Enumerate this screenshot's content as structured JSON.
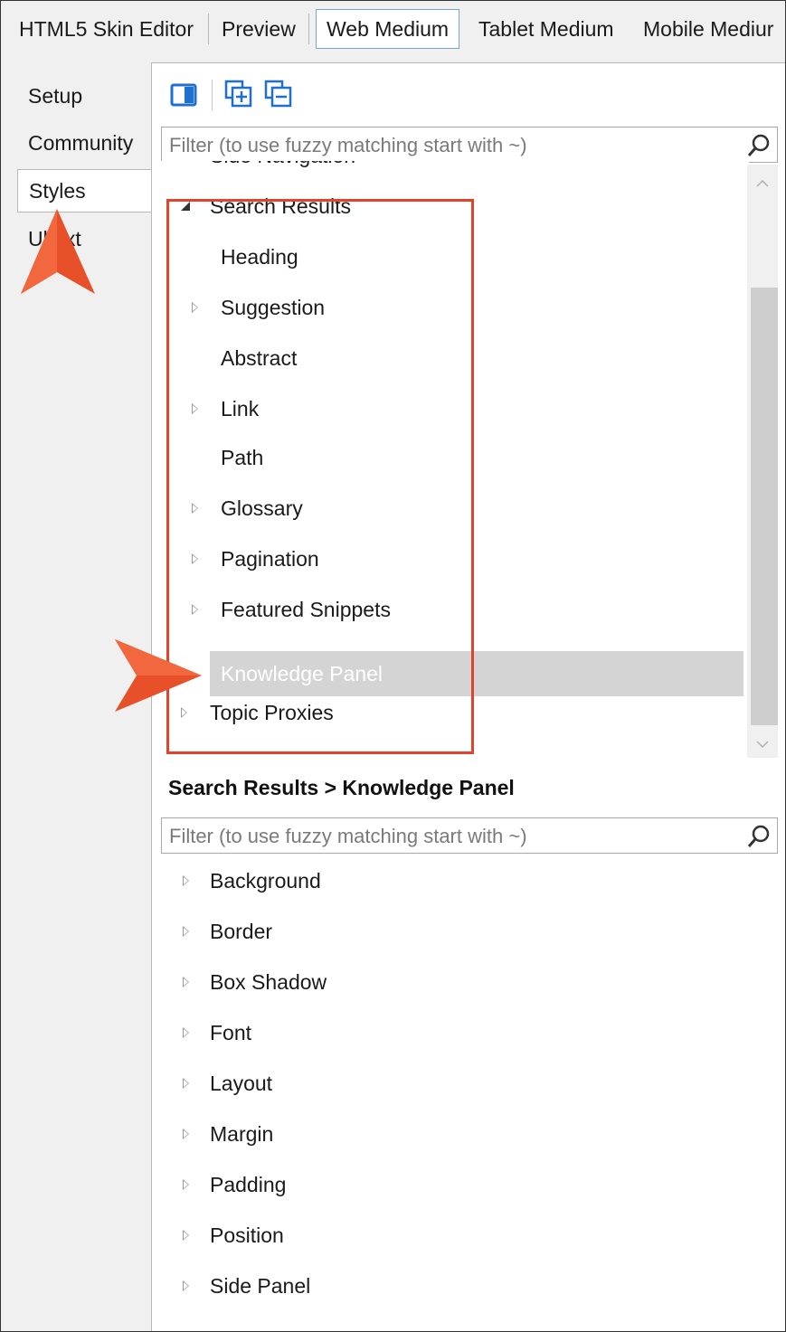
{
  "top_tabs": [
    {
      "label": "HTML5 Skin Editor"
    },
    {
      "label": "Preview"
    },
    {
      "label": "Web Medium"
    },
    {
      "label": "Tablet Medium"
    },
    {
      "label": "Mobile Mediur"
    }
  ],
  "left_tabs": [
    {
      "label": "Setup"
    },
    {
      "label": "Community"
    },
    {
      "label": "Styles"
    },
    {
      "label": "UI Text",
      "visible": "Ul  ext"
    }
  ],
  "filter_placeholder": "Filter (to use fuzzy matching start with ~)",
  "tree": {
    "items": [
      {
        "label": "Side Navigation",
        "level": 0,
        "arrow": "collapsed"
      },
      {
        "label": "Search Results",
        "level": 0,
        "arrow": "expanded"
      },
      {
        "label": "Heading",
        "level": 1,
        "arrow": "none"
      },
      {
        "label": "Suggestion",
        "level": 1,
        "arrow": "collapsed"
      },
      {
        "label": "Abstract",
        "level": 1,
        "arrow": "none"
      },
      {
        "label": "Link",
        "level": 1,
        "arrow": "collapsed"
      },
      {
        "label": "Path",
        "level": 1,
        "arrow": "none"
      },
      {
        "label": "Glossary",
        "level": 1,
        "arrow": "collapsed"
      },
      {
        "label": "Pagination",
        "level": 1,
        "arrow": "collapsed"
      },
      {
        "label": "Featured Snippets",
        "level": 1,
        "arrow": "collapsed"
      },
      {
        "label": "Knowledge Panel",
        "level": 1,
        "arrow": "none",
        "selected": true
      },
      {
        "label": "Topic Proxies",
        "level": 0,
        "arrow": "collapsed"
      }
    ]
  },
  "breadcrumb_title": "Search Results > Knowledge Panel",
  "properties": [
    {
      "label": "Background"
    },
    {
      "label": "Border"
    },
    {
      "label": "Box Shadow"
    },
    {
      "label": "Font"
    },
    {
      "label": "Layout"
    },
    {
      "label": "Margin"
    },
    {
      "label": "Padding"
    },
    {
      "label": "Position"
    },
    {
      "label": "Side Panel"
    }
  ],
  "colors": {
    "highlight": "#e4422a",
    "callout": "#e8502a",
    "selected_row": "#d4d4d4",
    "active_tab_border": "#6ea6d8"
  }
}
